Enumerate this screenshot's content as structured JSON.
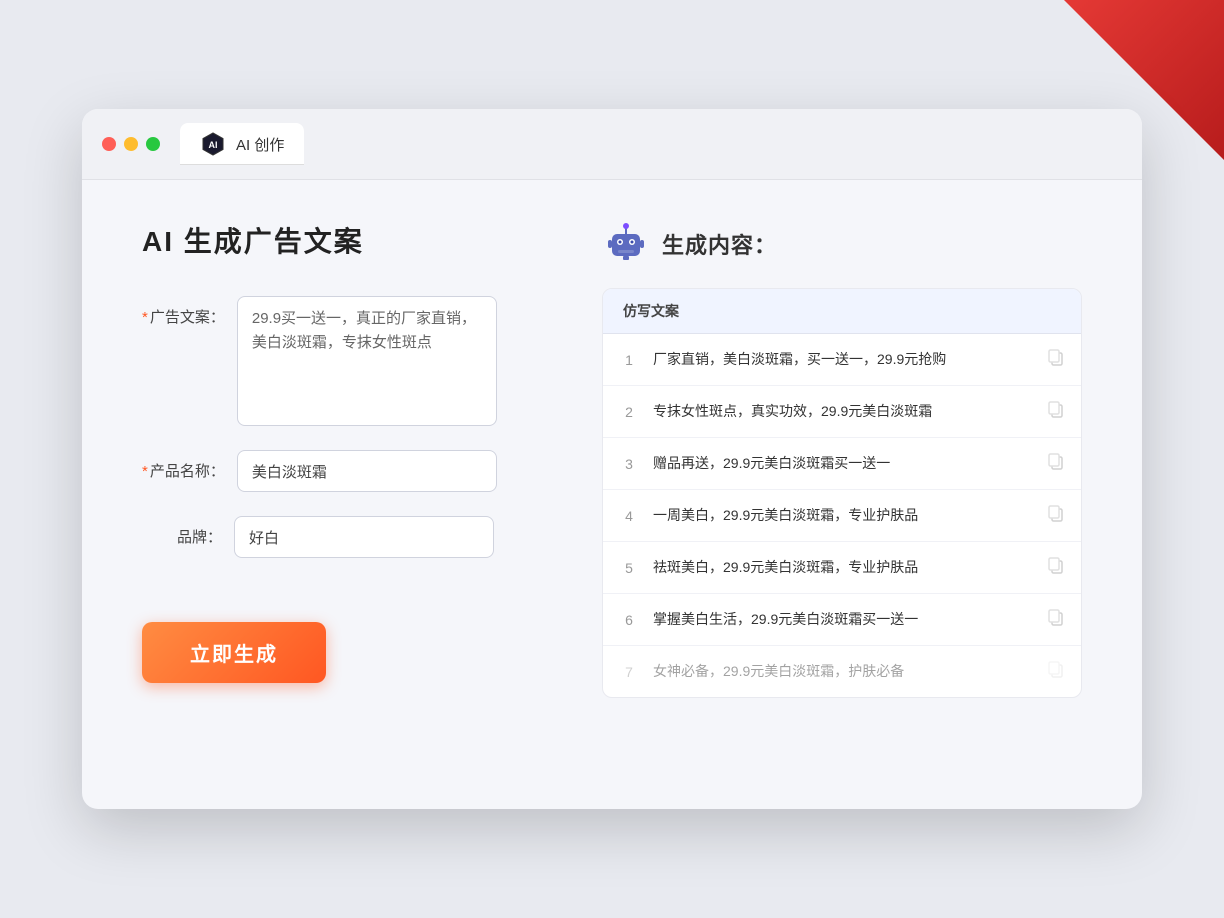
{
  "window": {
    "tab_label": "AI 创作"
  },
  "left_panel": {
    "page_title": "AI 生成广告文案",
    "ad_copy_label": "广告文案：",
    "ad_copy_required": "*",
    "ad_copy_value": "29.9买一送一，真正的厂家直销，美白淡斑霜，专抹女性斑点",
    "product_name_label": "产品名称：",
    "product_name_required": "*",
    "product_name_value": "美白淡斑霜",
    "brand_label": "品牌：",
    "brand_value": "好白",
    "generate_btn_label": "立即生成"
  },
  "right_panel": {
    "result_title": "生成内容：",
    "column_header": "仿写文案",
    "results": [
      {
        "num": "1",
        "text": "厂家直销，美白淡斑霜，买一送一，29.9元抢购",
        "faded": false
      },
      {
        "num": "2",
        "text": "专抹女性斑点，真实功效，29.9元美白淡斑霜",
        "faded": false
      },
      {
        "num": "3",
        "text": "赠品再送，29.9元美白淡斑霜买一送一",
        "faded": false
      },
      {
        "num": "4",
        "text": "一周美白，29.9元美白淡斑霜，专业护肤品",
        "faded": false
      },
      {
        "num": "5",
        "text": "祛斑美白，29.9元美白淡斑霜，专业护肤品",
        "faded": false
      },
      {
        "num": "6",
        "text": "掌握美白生活，29.9元美白淡斑霜买一送一",
        "faded": false
      },
      {
        "num": "7",
        "text": "女神必备，29.9元美白淡斑霜，护肤必备",
        "faded": true
      }
    ]
  }
}
